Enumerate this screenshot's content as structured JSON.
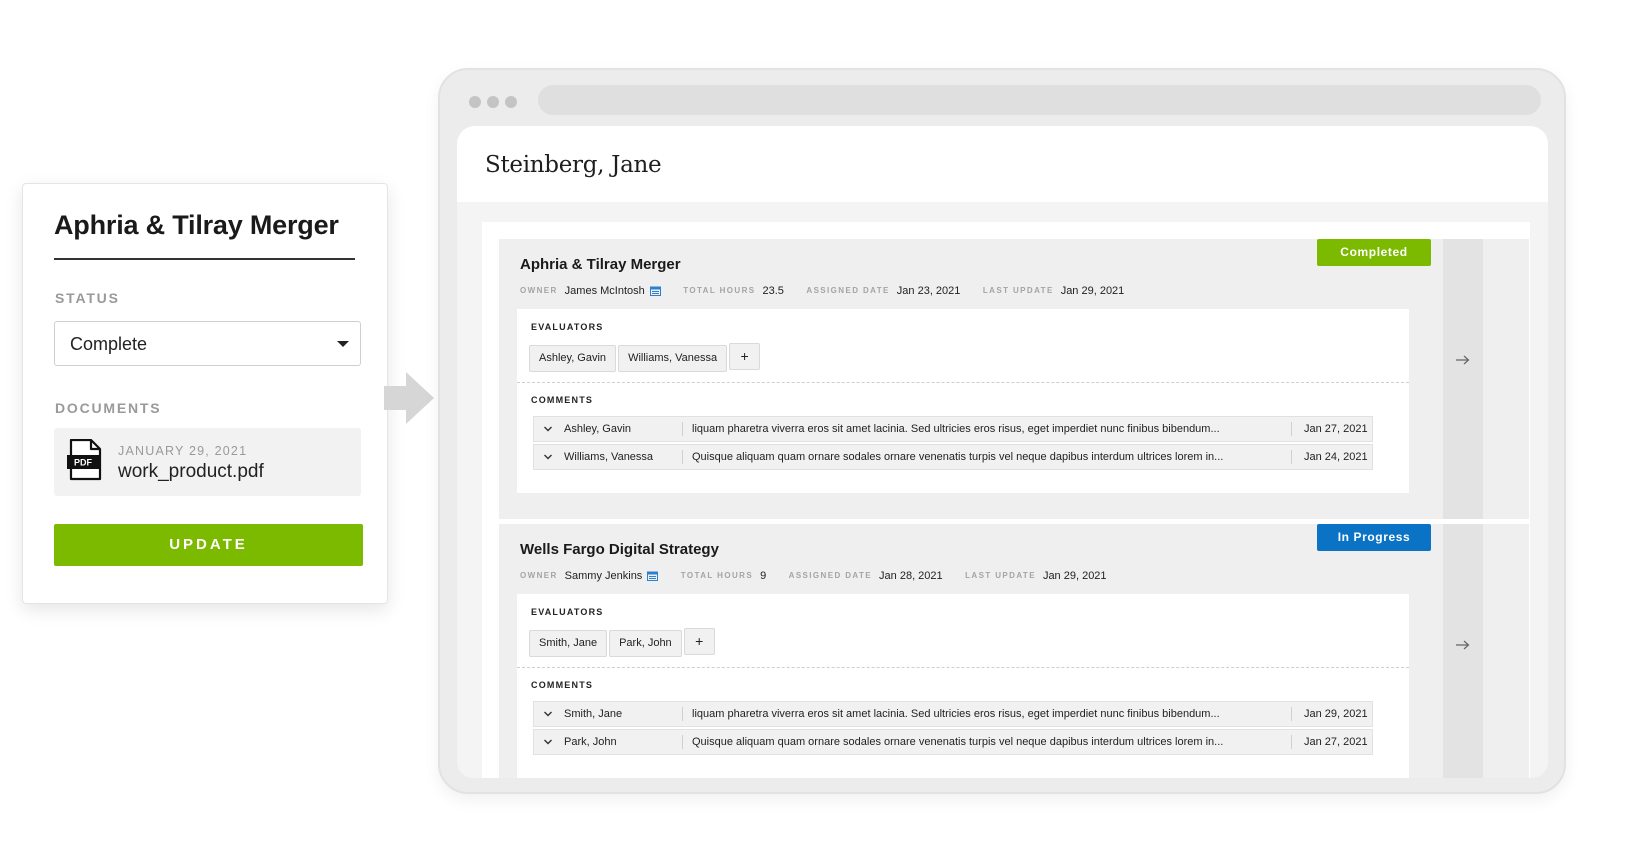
{
  "edit_card": {
    "title": "Aphria & Tilray Merger",
    "status_label": "STATUS",
    "status_value": "Complete",
    "documents_label": "DOCUMENTS",
    "document": {
      "date": "JANUARY 29, 2021",
      "name": "work_product.pdf",
      "icon_text": "PDF"
    },
    "update_button": "UPDATE"
  },
  "browser": {
    "page_title": "Steinberg, Jane",
    "labels": {
      "owner": "OWNER",
      "total_hours": "TOTAL HOURS",
      "assigned_date": "ASSIGNED DATE",
      "last_update": "LAST UPDATE",
      "evaluators": "EVALUATORS",
      "comments": "COMMENTS",
      "add": "+"
    },
    "projects": [
      {
        "title": "Aphria & Tilray Merger",
        "status": "Completed",
        "owner": "James McIntosh",
        "total_hours": "23.5",
        "assigned_date": "Jan 23, 2021",
        "last_update": "Jan 29, 2021",
        "evaluators": [
          "Ashley, Gavin",
          "Williams, Vanessa"
        ],
        "comments": [
          {
            "name": "Ashley, Gavin",
            "text": "liquam pharetra viverra eros sit amet lacinia. Sed ultricies eros risus, eget imperdiet nunc finibus bibendum...",
            "date": "Jan 27, 2021"
          },
          {
            "name": "Williams, Vanessa",
            "text": "Quisque aliquam quam ornare sodales ornare venenatis turpis vel neque dapibus interdum ultrices lorem in...",
            "date": "Jan 24, 2021"
          }
        ]
      },
      {
        "title": "Wells Fargo Digital Strategy",
        "status": "In Progress",
        "owner": "Sammy Jenkins",
        "total_hours": "9",
        "assigned_date": "Jan 28, 2021",
        "last_update": "Jan 29, 2021",
        "evaluators": [
          "Smith, Jane",
          "Park, John"
        ],
        "comments": [
          {
            "name": "Smith, Jane",
            "text": "liquam pharetra viverra eros sit amet lacinia. Sed ultricies eros risus, eget imperdiet nunc finibus bibendum...",
            "date": "Jan 29, 2021"
          },
          {
            "name": "Park, John",
            "text": "Quisque aliquam quam ornare sodales ornare venenatis turpis vel neque dapibus interdum ultrices lorem in...",
            "date": "Jan 27, 2021"
          }
        ]
      }
    ]
  },
  "colors": {
    "accent_green": "#7cba00",
    "status_blue": "#0a73c6",
    "calendar_blue": "#2d7fd0"
  },
  "icons": [
    "caret-down-icon",
    "pdf-icon",
    "arrow-right-icon",
    "calendar-icon",
    "chevron-down-icon",
    "flow-arrow-icon"
  ]
}
